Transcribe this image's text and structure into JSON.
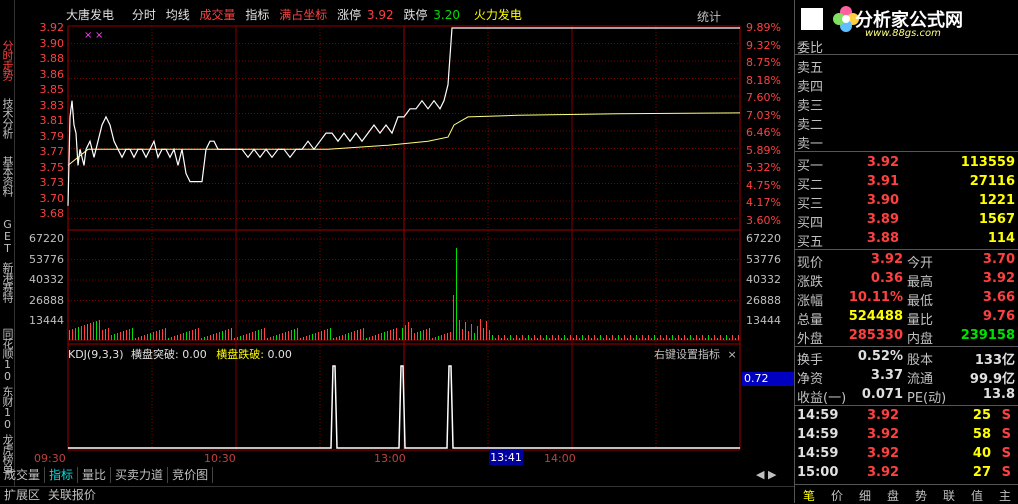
{
  "left_tabs": [
    "分时走势",
    "技术分析",
    "基本资料",
    "GET",
    "新港赛特",
    "同花顺10",
    "东财10",
    "龙虎榜单"
  ],
  "topbar": {
    "stock_name": "大唐发电",
    "menu": [
      "分时",
      "均线",
      "成交量",
      "指标"
    ],
    "full_coord": "满占坐标",
    "limit_up_label": "涨停",
    "limit_up_value": "3.92",
    "limit_down_label": "跌停",
    "limit_down_value": "3.20",
    "sector": "火力发电",
    "stats": "统计"
  },
  "price_axis": [
    "3.92",
    "3.90",
    "3.88",
    "3.86",
    "3.85",
    "3.83",
    "3.81",
    "3.79",
    "3.77",
    "3.75",
    "3.73",
    "3.70",
    "3.68"
  ],
  "pct_axis": [
    "9.89%",
    "9.32%",
    "8.75%",
    "8.18%",
    "7.60%",
    "7.03%",
    "6.46%",
    "5.89%",
    "5.32%",
    "4.75%",
    "4.17%",
    "3.60%"
  ],
  "vol_axis_left": [
    "67220",
    "53776",
    "40332",
    "26888",
    "13444"
  ],
  "vol_axis_right": [
    "67220",
    "53776",
    "40332",
    "26888",
    "13444"
  ],
  "kdj": {
    "title": "KDJ(9,3,3)",
    "break_up_label": "横盘突破:",
    "break_up_value": "0.00",
    "break_down_label": "横盘跌破:",
    "break_down_value": "0.00",
    "settings": "右键设置指标",
    "value": "0.72"
  },
  "time_axis": [
    "09:30",
    "10:30",
    "13:00",
    "14:00"
  ],
  "cursor_time": "13:41",
  "bottom_tabs": [
    "成交量",
    "指标",
    "量比",
    "买卖力道",
    "竞价图"
  ],
  "status_tabs": [
    "扩展区",
    "关联报价"
  ],
  "logo": {
    "text": "分析家公式网",
    "url": "www.88gs.com"
  },
  "orderbook": {
    "ratio_label": "委比",
    "sells": [
      {
        "label": "卖五",
        "price": "",
        "vol": ""
      },
      {
        "label": "卖四",
        "price": "",
        "vol": ""
      },
      {
        "label": "卖三",
        "price": "",
        "vol": ""
      },
      {
        "label": "卖二",
        "price": "",
        "vol": ""
      },
      {
        "label": "卖一",
        "price": "",
        "vol": ""
      }
    ],
    "buys": [
      {
        "label": "买一",
        "price": "3.92",
        "vol": "113559"
      },
      {
        "label": "买二",
        "price": "3.91",
        "vol": "27116"
      },
      {
        "label": "买三",
        "price": "3.90",
        "vol": "1221"
      },
      {
        "label": "买四",
        "price": "3.89",
        "vol": "1567"
      },
      {
        "label": "买五",
        "price": "3.88",
        "vol": "114"
      }
    ]
  },
  "quote": [
    {
      "l1": "现价",
      "v1": "3.92",
      "c1": "red",
      "l2": "今开",
      "v2": "3.70",
      "c2": "red"
    },
    {
      "l1": "涨跌",
      "v1": "0.36",
      "c1": "red",
      "l2": "最高",
      "v2": "3.92",
      "c2": "red"
    },
    {
      "l1": "涨幅",
      "v1": "10.11%",
      "c1": "red",
      "l2": "最低",
      "v2": "3.66",
      "c2": "red"
    },
    {
      "l1": "总量",
      "v1": "524488",
      "c1": "yel",
      "l2": "量比",
      "v2": "9.76",
      "c2": "red"
    },
    {
      "l1": "外盘",
      "v1": "285330",
      "c1": "red",
      "l2": "内盘",
      "v2": "239158",
      "c2": "grn"
    }
  ],
  "fundamentals": [
    {
      "l1": "换手",
      "v1": "0.52%",
      "c1": "wht",
      "l2": "股本",
      "v2": "133亿",
      "c2": "wht"
    },
    {
      "l1": "净资",
      "v1": "3.37",
      "c1": "wht",
      "l2": "流通",
      "v2": "99.9亿",
      "c2": "wht"
    },
    {
      "l1": "收益(一)",
      "v1": "0.071",
      "c1": "wht",
      "l2": "PE(动)",
      "v2": "13.8",
      "c2": "wht"
    }
  ],
  "ticks": [
    {
      "time": "14:59",
      "price": "3.92",
      "vol": "25",
      "dir": "S"
    },
    {
      "time": "14:59",
      "price": "3.92",
      "vol": "58",
      "dir": "S"
    },
    {
      "time": "14:59",
      "price": "3.92",
      "vol": "40",
      "dir": "S"
    },
    {
      "time": "15:00",
      "price": "3.92",
      "vol": "27",
      "dir": "S"
    }
  ],
  "right_tabs": [
    "笔",
    "价",
    "细",
    "盘",
    "势",
    "联",
    "值",
    "主"
  ],
  "colors": {
    "up": "#ff4040",
    "down": "#00e000",
    "avg": "#ffff80",
    "price_line": "#ffffff",
    "bg": "#000000",
    "grid": "#a00000"
  }
}
